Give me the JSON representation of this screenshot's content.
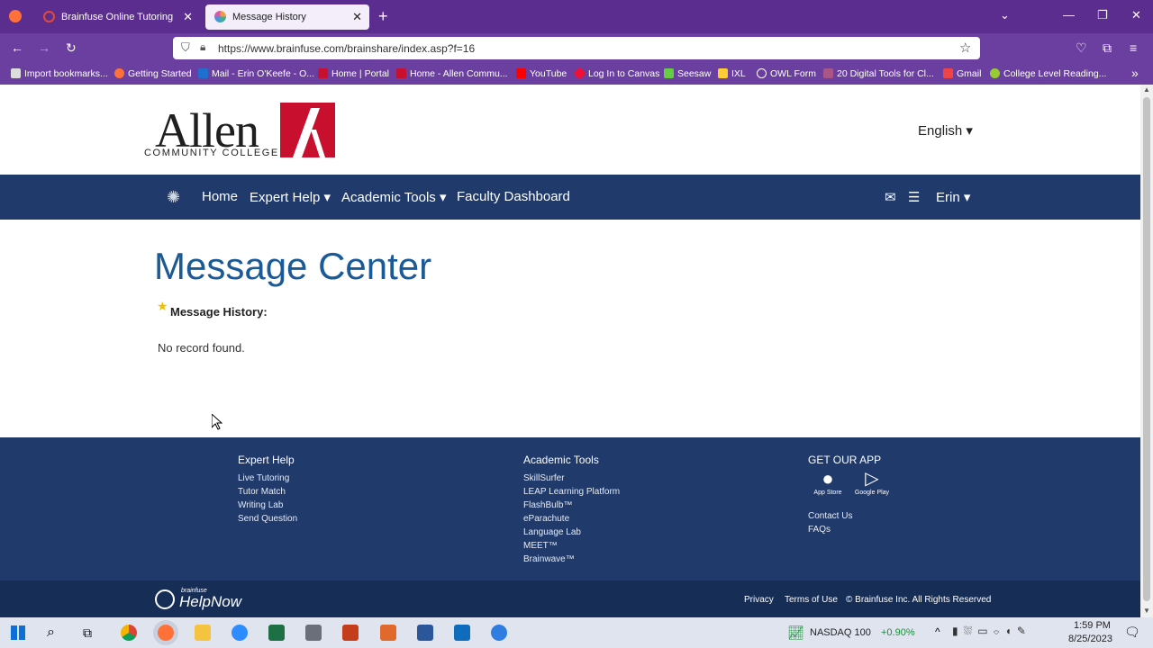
{
  "browser": {
    "tabs": [
      {
        "title": "Brainfuse Online Tutoring",
        "active": false
      },
      {
        "title": "Message History",
        "active": true
      }
    ],
    "url": "https://www.brainfuse.com/brainshare/index.asp?f=16",
    "bookmarks": [
      "Import bookmarks...",
      "Getting Started",
      "Mail - Erin O'Keefe - O...",
      "Home | Portal",
      "Home - Allen Commu...",
      "YouTube",
      "Log In to Canvas",
      "Seesaw",
      "IXL",
      "OWL Form",
      "20 Digital Tools for Cl...",
      "Gmail",
      "College Level Reading..."
    ]
  },
  "header": {
    "logo_word": "Allen",
    "logo_sub": "COMMUNITY COLLEGE",
    "language": "English"
  },
  "nav": {
    "home": "Home",
    "expert_help": "Expert Help",
    "academic_tools": "Academic Tools",
    "faculty_dashboard": "Faculty Dashboard",
    "user": "Erin"
  },
  "main": {
    "title": "Message Center",
    "history_label": "Message History:",
    "empty_text": "No record found."
  },
  "footer": {
    "col1": {
      "heading": "Expert Help",
      "links": [
        "Live Tutoring",
        "Tutor Match",
        "Writing Lab",
        "Send Question"
      ]
    },
    "col2": {
      "heading": "Academic Tools",
      "links": [
        "SkillSurfer",
        "LEAP Learning Platform",
        "FlashBulb™",
        "eParachute",
        "Language Lab",
        "MEET™",
        "Brainwave™"
      ]
    },
    "col3": {
      "heading": "GET OUR APP",
      "links": [
        "Contact Us",
        "FAQs"
      ],
      "app_store": "App Store",
      "google_play": "Google Play"
    },
    "brand_small": "brainfuse",
    "brand": "HelpNow",
    "privacy": "Privacy",
    "terms": "Terms of Use",
    "copyright": "© Brainfuse Inc. All Rights Reserved"
  },
  "taskbar": {
    "ticker": "NASDAQ 100",
    "ticker_change": "+0.90%",
    "time": "1:59 PM",
    "date": "8/25/2023"
  }
}
